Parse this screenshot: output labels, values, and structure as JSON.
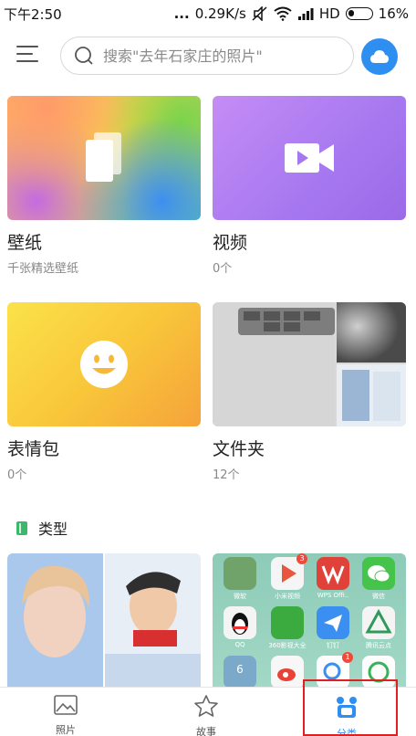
{
  "status_bar": {
    "time": "下午2:50",
    "dots": "...",
    "speed": "0.29K/s",
    "network": "HD",
    "battery": "16%"
  },
  "header": {
    "search_placeholder": "搜索\"去年石家庄的照片\""
  },
  "albums": [
    {
      "title": "壁纸",
      "subtitle": "千张精选壁纸"
    },
    {
      "title": "视频",
      "subtitle": "0个"
    },
    {
      "title": "表情包",
      "subtitle": "0个"
    },
    {
      "title": "文件夹",
      "subtitle": "12个"
    }
  ],
  "section": {
    "type_label": "类型"
  },
  "app_grid": {
    "labels": [
      "微软",
      "小米视频",
      "WPS Offi..",
      "微信",
      "QQ",
      "360影视大全",
      "钉钉",
      "腾讯云点"
    ],
    "badges": [
      "3",
      "1"
    ],
    "calendar_day": "6"
  },
  "bottom_nav": {
    "photos": "照片",
    "stories": "故事",
    "categories": "分类"
  },
  "colors": {
    "accent": "#2f8ff0",
    "highlight": "#e02020",
    "section_icon": "#3cb86a"
  }
}
